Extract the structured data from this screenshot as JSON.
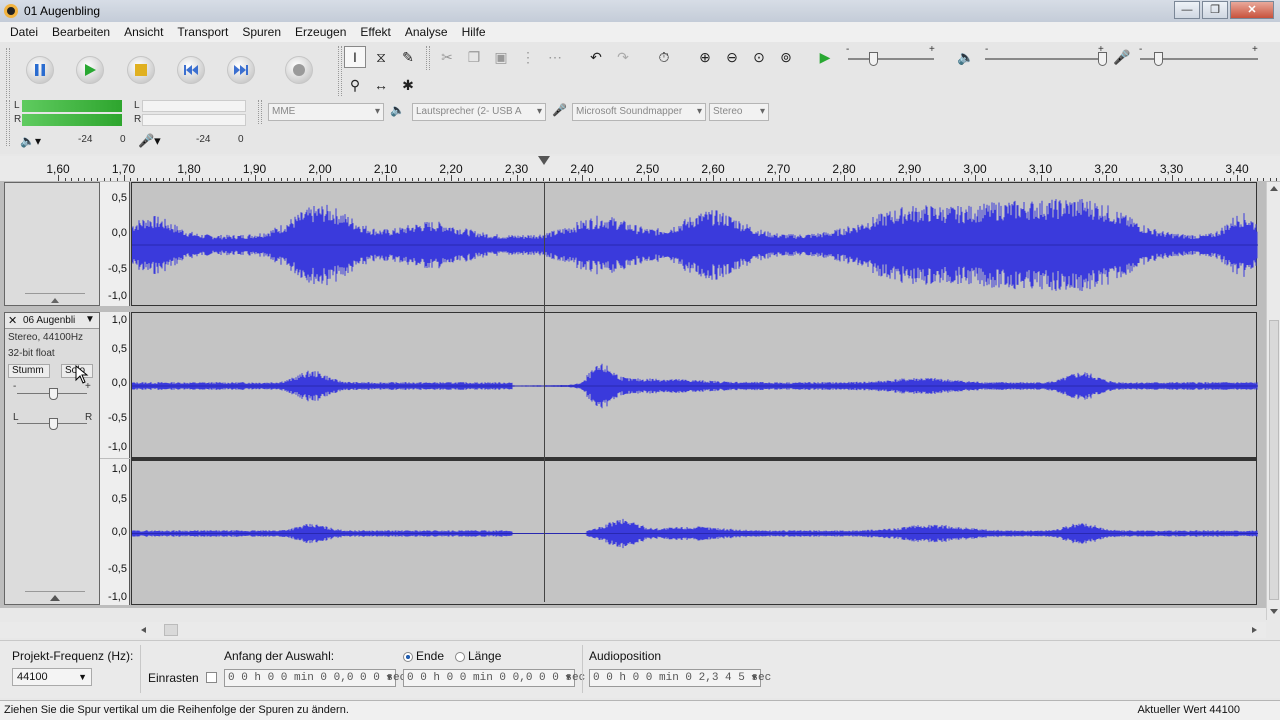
{
  "window": {
    "title": "01 Augenbling"
  },
  "menu": [
    "Datei",
    "Bearbeiten",
    "Ansicht",
    "Transport",
    "Spuren",
    "Erzeugen",
    "Effekt",
    "Analyse",
    "Hilfe"
  ],
  "meters": {
    "left": "L",
    "right": "R",
    "scale_a": "-24",
    "scale_b": "0",
    "scale_c": "-24",
    "scale_d": "0"
  },
  "device": {
    "host": "MME",
    "output": "Lautsprecher (2- USB A",
    "input": "Microsoft Soundmapper",
    "channels": "Stereo"
  },
  "sliders": {
    "minus": "-",
    "plus": "+"
  },
  "ruler": {
    "ticks": [
      "1,60",
      "1,70",
      "1,80",
      "1,90",
      "2,00",
      "2,10",
      "2,20",
      "2,30",
      "2,40",
      "2,50",
      "2,60",
      "2,70",
      "2,80",
      "2,90",
      "3,00",
      "3,10",
      "3,20",
      "3,30",
      "3,40"
    ]
  },
  "track1": {
    "axis": [
      "0,5",
      "0,0",
      "-0,5",
      "-1,0"
    ]
  },
  "track2": {
    "name": "06 Augenbli",
    "info1": "Stereo, 44100Hz",
    "info2": "32-bit float",
    "mute": "Stumm",
    "solo": "Solo",
    "axis_left": [
      "1,0",
      "0,5",
      "0,0",
      "-0,5",
      "-1,0"
    ],
    "axis_right": [
      "1,0",
      "0,5",
      "0,0",
      "-0,5",
      "-1,0"
    ]
  },
  "selection": {
    "rate_label": "Projekt-Frequenz (Hz):",
    "rate_value": "44100",
    "snap_label": "Einrasten",
    "start_label": "Anfang der Auswahl:",
    "end_label": "Ende",
    "length_label": "Länge",
    "pos_label": "Audioposition",
    "start_time": "0 0 h 0 0 min 0 0,0 0 0 sec",
    "end_time": "0 0 h 0 0 min 0 0,0 0 0 sec",
    "pos_time": "0 0 h 0 0 min 0 2,3 4 5 sec"
  },
  "status": {
    "message": "Ziehen Sie die Spur vertikal um die Reihenfolge der Spuren zu ändern.",
    "right": "Aktueller Wert 44100"
  },
  "colors": {
    "wave": "#3a3adc",
    "wave_bg": "#c4c4c4"
  }
}
